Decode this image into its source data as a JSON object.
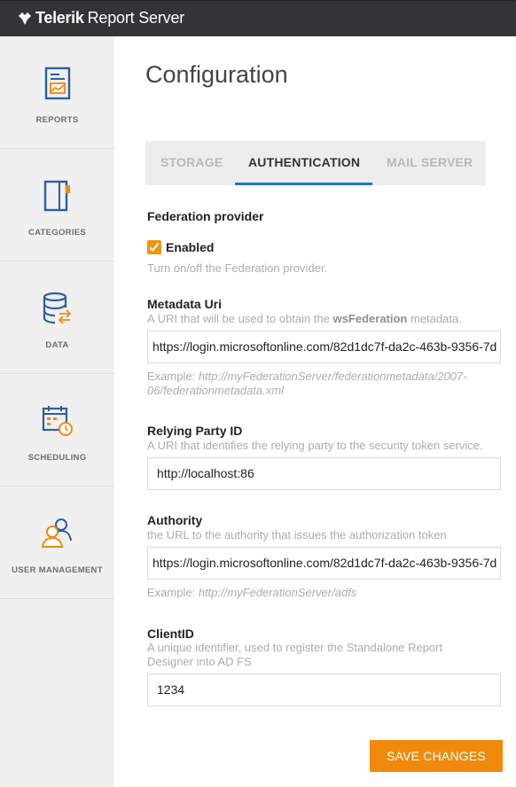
{
  "app": {
    "brand_bold": "Telerik",
    "brand_rest": "Report Server"
  },
  "sidebar": {
    "items": [
      {
        "label": "REPORTS",
        "icon": "reports-icon"
      },
      {
        "label": "CATEGORIES",
        "icon": "categories-icon"
      },
      {
        "label": "DATA",
        "icon": "data-icon"
      },
      {
        "label": "SCHEDULING",
        "icon": "scheduling-icon"
      },
      {
        "label": "USER MANAGEMENT",
        "icon": "user-management-icon"
      }
    ]
  },
  "page": {
    "title": "Configuration"
  },
  "tabs": [
    {
      "label": "STORAGE",
      "active": false
    },
    {
      "label": "AUTHENTICATION",
      "active": true
    },
    {
      "label": "MAIL SERVER",
      "active": false
    }
  ],
  "federation": {
    "title": "Federation provider",
    "enabled_label": "Enabled",
    "enabled": true,
    "enabled_desc": "Turn on/off the Federation provider."
  },
  "metadata_uri": {
    "label": "Metadata Uri",
    "desc_prefix": "A URI that will be used to obtain the ",
    "desc_bold": "wsFederation",
    "desc_suffix": " metadata.",
    "value": "https://login.microsoftonline.com/82d1dc7f-da2c-463b-9356-7d",
    "example_prefix": "Example: ",
    "example_value": "http://myFederationServer/federationmetadata/2007-06/federationmetadata.xml"
  },
  "relying_party": {
    "label": "Relying Party ID",
    "desc": "A URI that identifies the relying party to the security token service.",
    "value": "http://localhost:86"
  },
  "authority": {
    "label": "Authority",
    "desc": "the URL to the authority that issues the authorization token",
    "value": "https://login.microsoftonline.com/82d1dc7f-da2c-463b-9356-7d",
    "example_prefix": "Example: ",
    "example_value": "http://myFederationServer/adfs"
  },
  "client_id": {
    "label": "ClientID",
    "desc": "A unique identifier, used to register the Standalone Report Designer into AD FS",
    "value": "1234"
  },
  "actions": {
    "save_label": "SAVE CHANGES"
  },
  "colors": {
    "accent": "#ef8a0c",
    "tab_underline": "#1976c7",
    "topbar": "#333436",
    "sidebar": "#f0f0f0",
    "icon_blue": "#2a5fa3"
  }
}
